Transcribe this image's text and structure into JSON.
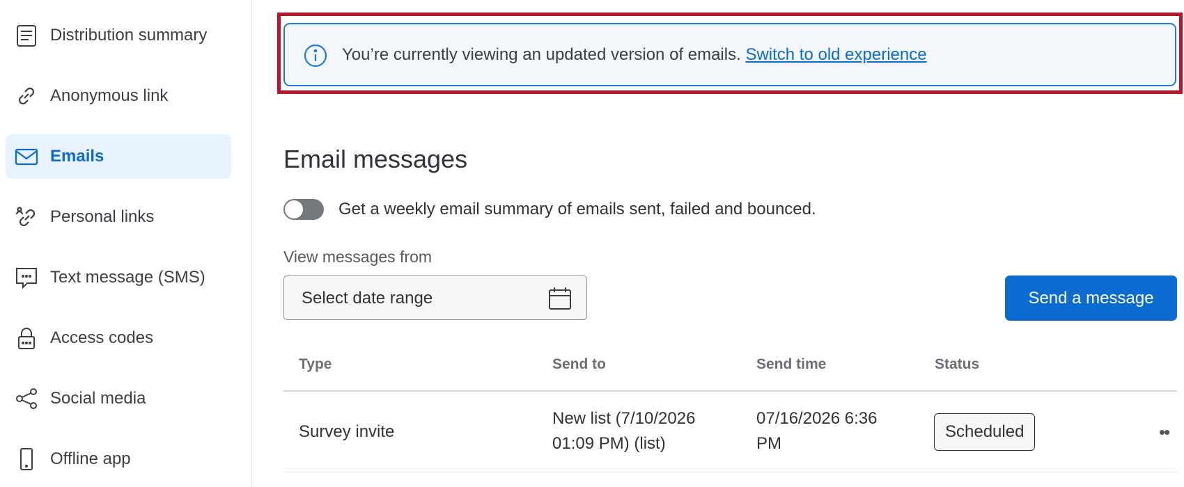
{
  "sidebar": {
    "items": [
      {
        "label": "Distribution summary",
        "icon": "distribution-summary-icon"
      },
      {
        "label": "Anonymous link",
        "icon": "link-icon"
      },
      {
        "label": "Emails",
        "icon": "envelope-icon",
        "active": true
      },
      {
        "label": "Personal links",
        "icon": "personal-link-icon"
      },
      {
        "label": "Text message (SMS)",
        "icon": "sms-icon"
      },
      {
        "label": "Access codes",
        "icon": "lock-icon"
      },
      {
        "label": "Social media",
        "icon": "share-icon"
      },
      {
        "label": "Offline app",
        "icon": "mobile-icon"
      }
    ]
  },
  "banner": {
    "message": "You’re currently viewing an updated version of emails.",
    "link_label": "Switch to old experience",
    "highlight_color": "#b5172b",
    "accent_color": "#1a7bd8"
  },
  "main": {
    "title": "Email messages",
    "toggle_label": "Get a weekly email summary of emails sent, failed and bounced.",
    "toggle_on": false,
    "view_label": "View messages from",
    "date_picker_placeholder": "Select date range",
    "send_button_label": "Send a message",
    "brand_color": "#0b6bd1"
  },
  "table": {
    "columns": [
      "Type",
      "Send to",
      "Send time",
      "Status"
    ],
    "rows": [
      {
        "type": "Survey invite",
        "send_to_line1": "New list (7/10/2026",
        "send_to_line2": "01:09 PM) (list)",
        "send_time_line1": "07/16/2026 6:36",
        "send_time_line2": "PM",
        "status": "Scheduled"
      }
    ]
  }
}
